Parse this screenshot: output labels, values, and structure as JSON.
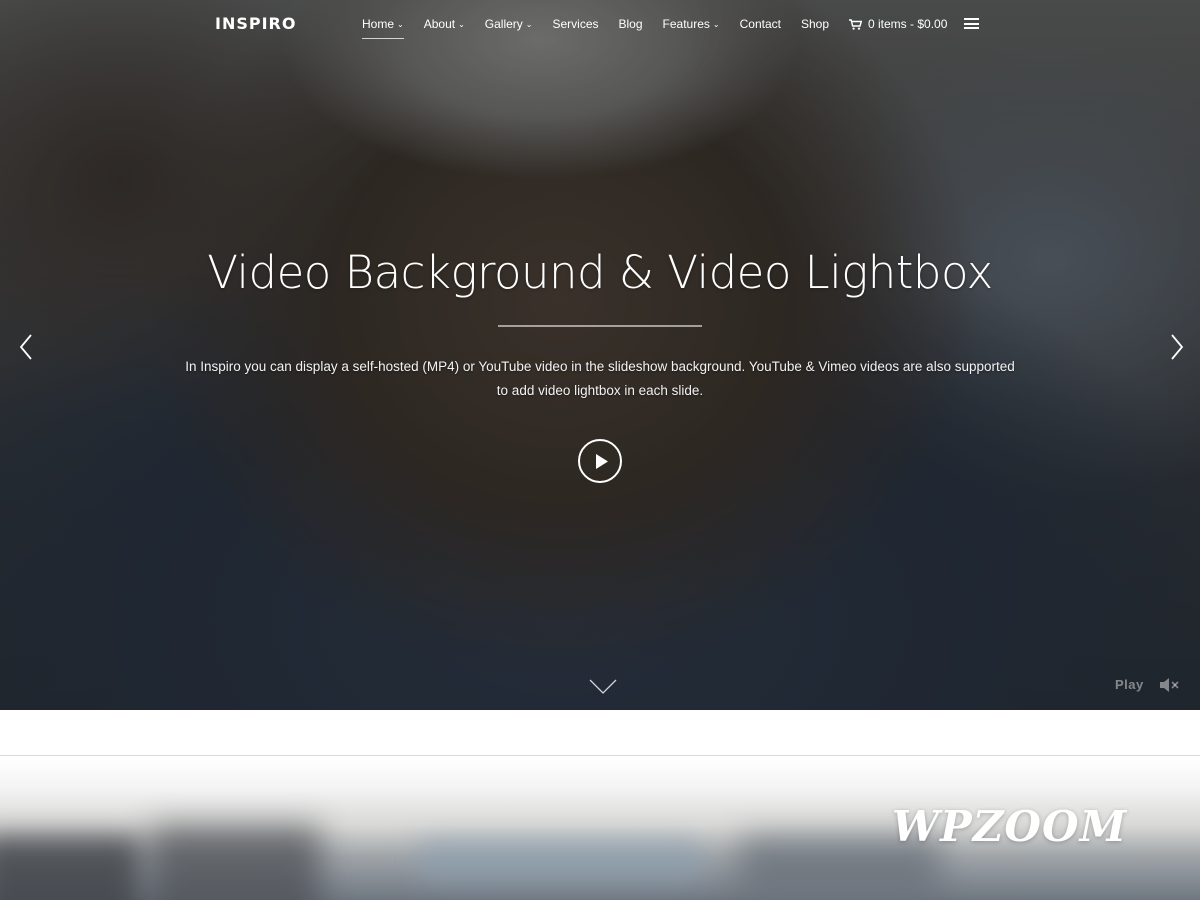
{
  "header": {
    "logo": "INSPIRO",
    "nav": [
      {
        "label": "Home",
        "has_dropdown": true,
        "active": true
      },
      {
        "label": "About",
        "has_dropdown": true
      },
      {
        "label": "Gallery",
        "has_dropdown": true
      },
      {
        "label": "Services",
        "has_dropdown": false
      },
      {
        "label": "Blog",
        "has_dropdown": false
      },
      {
        "label": "Features",
        "has_dropdown": true
      },
      {
        "label": "Contact",
        "has_dropdown": false
      },
      {
        "label": "Shop",
        "has_dropdown": false
      }
    ],
    "cart_label": "0 items - $0.00",
    "menu_icon": "hamburger-icon"
  },
  "hero": {
    "title": "Video Background & Video Lightbox",
    "description_line1": "In Inspiro you can display a self-hosted (MP4) or YouTube video in the slideshow background. YouTube & Vimeo videos are also supported",
    "description_line2": "to add video lightbox in each slide.",
    "play_icon": "play-circle-icon",
    "prev_icon": "chevron-left-icon",
    "next_icon": "chevron-right-icon",
    "scroll_icon": "chevron-down-icon",
    "video_control_label": "Play",
    "mute_icon": "speaker-muted-icon"
  },
  "watermark": "WPZOOM",
  "colors": {
    "text": "#ffffff",
    "overlay": "#2a3038",
    "page_bg": "#ffffff"
  }
}
